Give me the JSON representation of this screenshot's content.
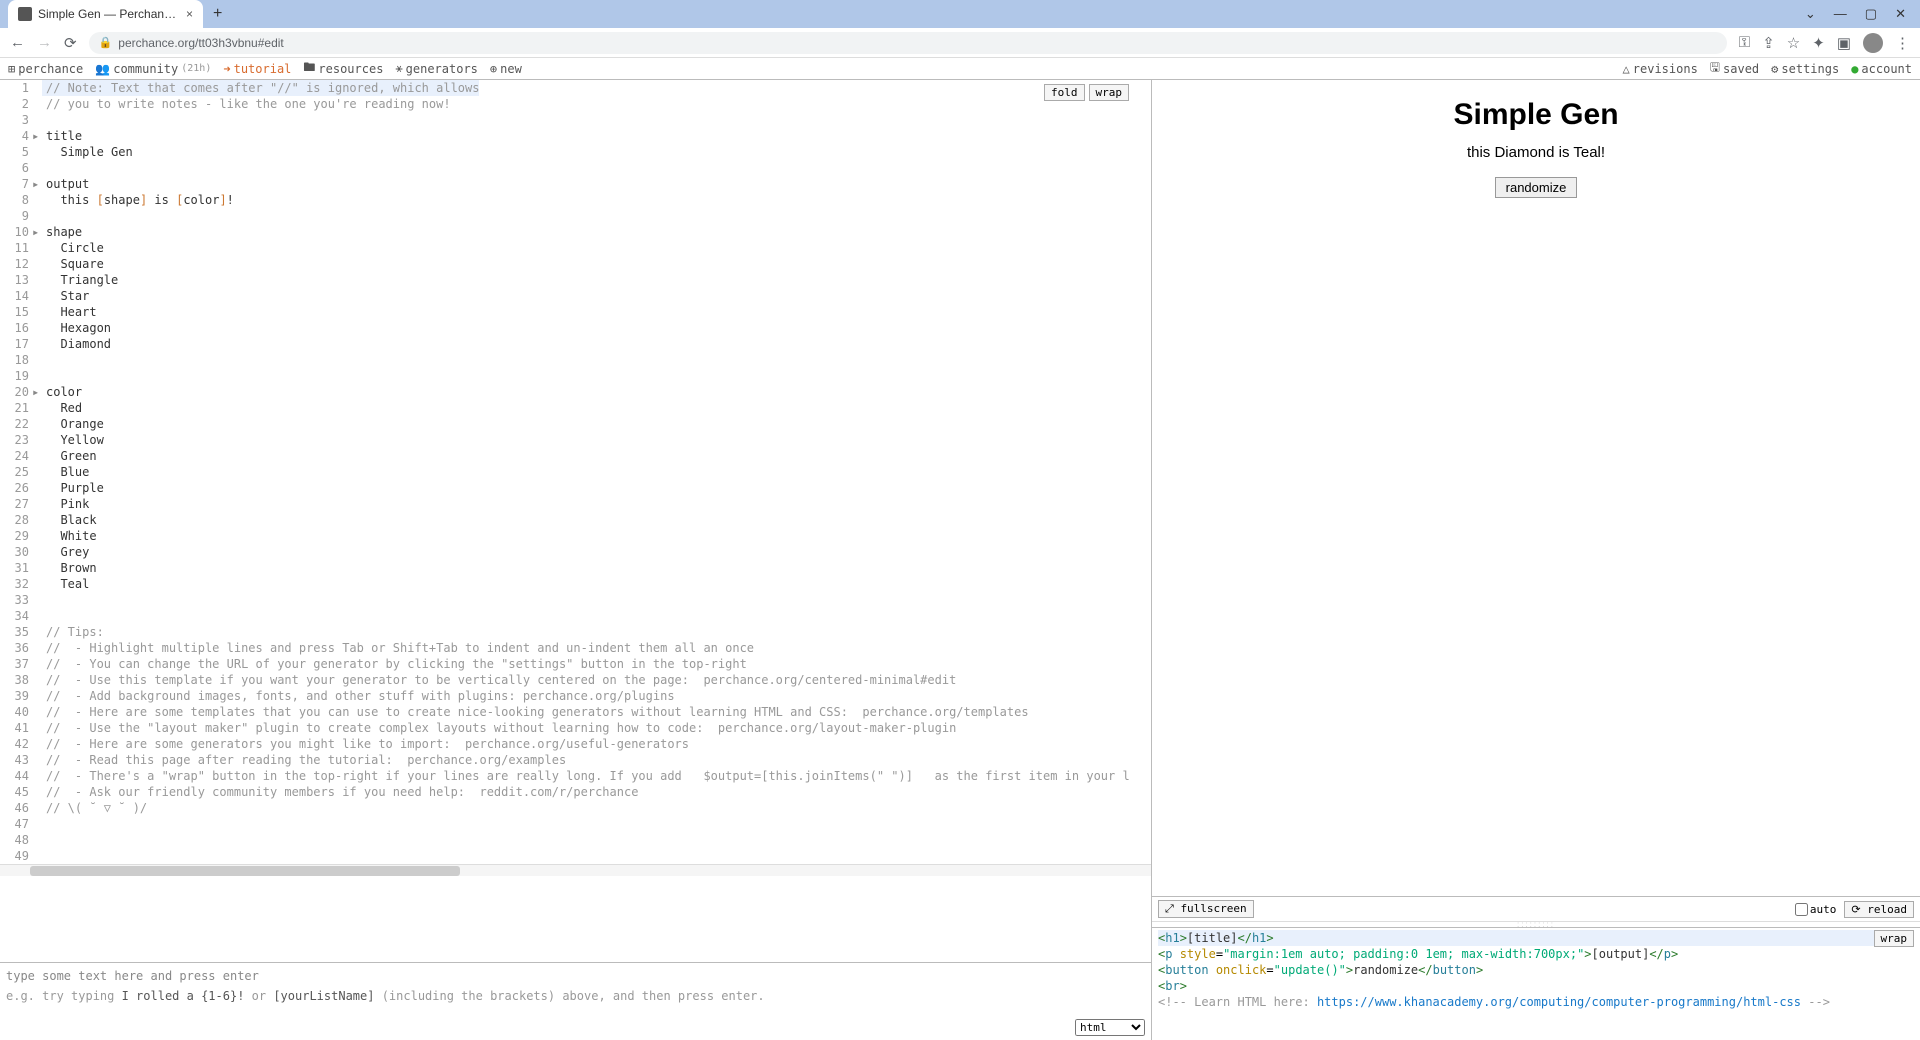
{
  "browser": {
    "tab_title": "Simple Gen — Perchance Genera",
    "url": "perchance.org/tt03h3vbnu#edit"
  },
  "site_nav": {
    "perchance": "perchance",
    "community": "community",
    "community_count": "(21h)",
    "tutorial": "tutorial",
    "resources": "resources",
    "generators": "generators",
    "new": "new",
    "revisions": "revisions",
    "saved": "saved",
    "settings": "settings",
    "account": "account"
  },
  "editor_buttons": {
    "fold": "fold",
    "wrap": "wrap"
  },
  "code": {
    "lines": [
      {
        "n": 1,
        "cls": "comment hl",
        "t": "// Note: Text that comes after \"//\" is ignored, which allows"
      },
      {
        "n": 2,
        "cls": "comment",
        "t": "// you to write notes - like the one you're reading now!"
      },
      {
        "n": 3,
        "cls": "",
        "t": ""
      },
      {
        "n": 4,
        "cls": "",
        "fold": true,
        "t": "title"
      },
      {
        "n": 5,
        "cls": "",
        "t": "  Simple Gen"
      },
      {
        "n": 6,
        "cls": "",
        "t": ""
      },
      {
        "n": 7,
        "cls": "",
        "fold": true,
        "t": "output"
      },
      {
        "n": 8,
        "cls": "",
        "html": "  this <span class='bracket-tag'>[</span>shape<span class='bracket-tag'>]</span> is <span class='bracket-tag'>[</span>color<span class='bracket-tag'>]</span>!"
      },
      {
        "n": 9,
        "cls": "",
        "t": ""
      },
      {
        "n": 10,
        "cls": "",
        "fold": true,
        "t": "shape"
      },
      {
        "n": 11,
        "cls": "",
        "t": "  Circle"
      },
      {
        "n": 12,
        "cls": "",
        "t": "  Square"
      },
      {
        "n": 13,
        "cls": "",
        "t": "  Triangle"
      },
      {
        "n": 14,
        "cls": "",
        "t": "  Star"
      },
      {
        "n": 15,
        "cls": "",
        "t": "  Heart"
      },
      {
        "n": 16,
        "cls": "",
        "t": "  Hexagon"
      },
      {
        "n": 17,
        "cls": "",
        "t": "  Diamond"
      },
      {
        "n": 18,
        "cls": "",
        "t": ""
      },
      {
        "n": 19,
        "cls": "",
        "t": ""
      },
      {
        "n": 20,
        "cls": "",
        "fold": true,
        "t": "color"
      },
      {
        "n": 21,
        "cls": "",
        "t": "  Red"
      },
      {
        "n": 22,
        "cls": "",
        "t": "  Orange"
      },
      {
        "n": 23,
        "cls": "",
        "t": "  Yellow"
      },
      {
        "n": 24,
        "cls": "",
        "t": "  Green"
      },
      {
        "n": 25,
        "cls": "",
        "t": "  Blue"
      },
      {
        "n": 26,
        "cls": "",
        "t": "  Purple"
      },
      {
        "n": 27,
        "cls": "",
        "t": "  Pink"
      },
      {
        "n": 28,
        "cls": "",
        "t": "  Black"
      },
      {
        "n": 29,
        "cls": "",
        "t": "  White"
      },
      {
        "n": 30,
        "cls": "",
        "t": "  Grey"
      },
      {
        "n": 31,
        "cls": "",
        "t": "  Brown"
      },
      {
        "n": 32,
        "cls": "",
        "t": "  Teal"
      },
      {
        "n": 33,
        "cls": "",
        "t": ""
      },
      {
        "n": 34,
        "cls": "",
        "t": ""
      },
      {
        "n": 35,
        "cls": "comment",
        "t": "// Tips:"
      },
      {
        "n": 36,
        "cls": "comment",
        "t": "//  - Highlight multiple lines and press Tab or Shift+Tab to indent and un-indent them all an once"
      },
      {
        "n": 37,
        "cls": "comment",
        "t": "//  - You can change the URL of your generator by clicking the \"settings\" button in the top-right"
      },
      {
        "n": 38,
        "cls": "comment",
        "t": "//  - Use this template if you want your generator to be vertically centered on the page:  perchance.org/centered-minimal#edit"
      },
      {
        "n": 39,
        "cls": "comment",
        "t": "//  - Add background images, fonts, and other stuff with plugins: perchance.org/plugins"
      },
      {
        "n": 40,
        "cls": "comment",
        "t": "//  - Here are some templates that you can use to create nice-looking generators without learning HTML and CSS:  perchance.org/templates"
      },
      {
        "n": 41,
        "cls": "comment",
        "t": "//  - Use the \"layout maker\" plugin to create complex layouts without learning how to code:  perchance.org/layout-maker-plugin"
      },
      {
        "n": 42,
        "cls": "comment",
        "t": "//  - Here are some generators you might like to import:  perchance.org/useful-generators"
      },
      {
        "n": 43,
        "cls": "comment",
        "t": "//  - Read this page after reading the tutorial:  perchance.org/examples"
      },
      {
        "n": 44,
        "cls": "comment",
        "t": "//  - There's a \"wrap\" button in the top-right if your lines are really long. If you add   $output=[this.joinItems(\" \")]   as the first item in your l"
      },
      {
        "n": 45,
        "cls": "comment",
        "t": "//  - Ask our friendly community members if you need help:  reddit.com/r/perchance"
      },
      {
        "n": 46,
        "cls": "comment",
        "t": "// \\( ˘ ▽ ˘ )/"
      },
      {
        "n": 47,
        "cls": "",
        "t": ""
      },
      {
        "n": 48,
        "cls": "",
        "t": ""
      },
      {
        "n": 49,
        "cls": "",
        "t": ""
      }
    ]
  },
  "test_area": {
    "placeholder": "type some text here and press enter",
    "help_prefix": "e.g. try typing ",
    "help_example1": "I rolled a {1-6}!",
    "help_mid": " or ",
    "help_example2": "[yourListName]",
    "help_suffix": " (including the brackets) above, and then press enter.",
    "format_option": "html"
  },
  "preview": {
    "title": "Simple Gen",
    "output": "this Diamond is Teal!",
    "btn": "randomize"
  },
  "preview_controls": {
    "fullscreen": "fullscreen",
    "auto": "auto",
    "reload": "reload",
    "wrap": "wrap"
  },
  "html_editor": {
    "line1": "<h1>[title]</h1>",
    "line2": "<p style=\"margin:1em auto; padding:0 1em; max-width:700px;\">[output]</p>",
    "line3": "<button onclick=\"update()\">randomize</button>",
    "line4": "<br>",
    "line5_a": "<!-- Learn HTML here:   ",
    "line5_b": "https://www.khanacademy.org/computing/computer-programming/html-css",
    "line5_c": "   -->"
  }
}
